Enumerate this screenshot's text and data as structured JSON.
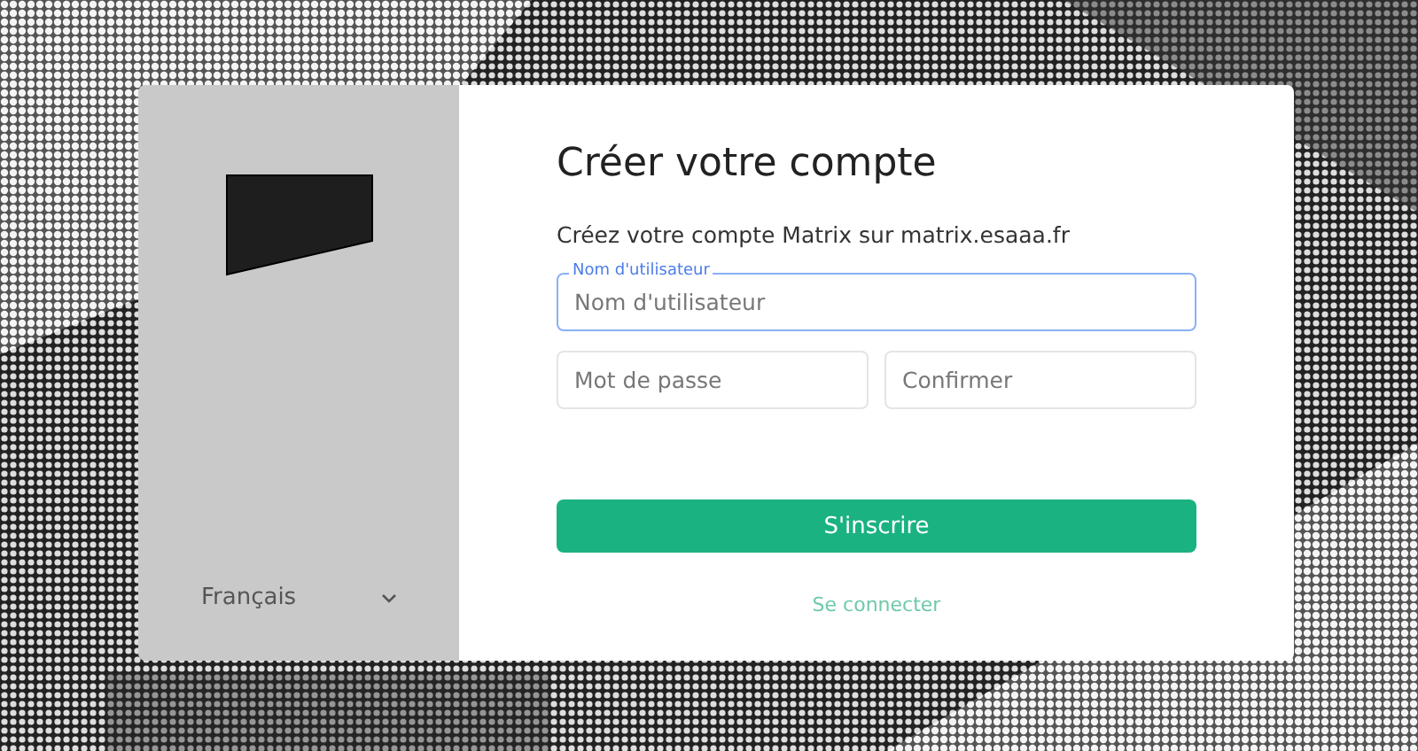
{
  "language_selector": {
    "label": "Français"
  },
  "form": {
    "title": "Créer votre compte",
    "subtitle": "Créez votre compte Matrix sur matrix.esaaa.fr",
    "field_rows": [
      [
        {
          "label": "Nom d'utilisateur",
          "placeholder": "Nom d'utilisateur",
          "focused": true
        }
      ],
      [
        {
          "placeholder": "Mot de passe",
          "focused": false
        },
        {
          "placeholder": "Confirmer",
          "focused": false
        }
      ]
    ],
    "submit": "S'inscrire",
    "login_link": "Se connecter"
  }
}
